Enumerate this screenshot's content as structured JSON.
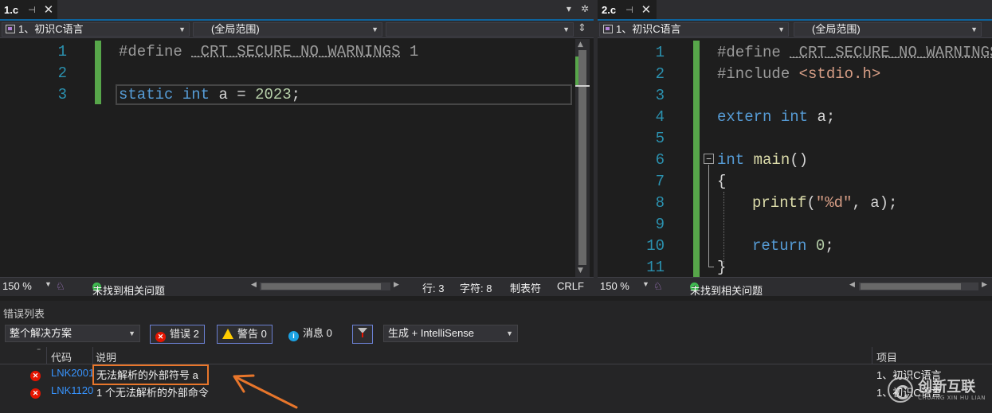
{
  "left_pane": {
    "tab_title": "1.c",
    "nav_project": "1、初识C语言",
    "nav_scope": "(全局范围)",
    "lines": [
      "1",
      "2",
      "3"
    ],
    "code": {
      "line1_directive": "#define",
      "line1_macro": "_CRT_SECURE_NO_WARNINGS",
      "line1_value": "1",
      "line3_kw1": "static",
      "line3_kw2": "int",
      "line3_rest": "a = ",
      "line3_num": "2023",
      "line3_semi": ";"
    },
    "status": {
      "zoom": "150 %",
      "issues": "未找到相关问题",
      "line": "行: 3",
      "char": "字符: 8",
      "tab_mode": "制表符",
      "eol": "CRLF"
    }
  },
  "right_pane": {
    "tab_title": "2.c",
    "nav_project": "1、初识C语言",
    "nav_scope": "(全局范围)",
    "lines": [
      "1",
      "2",
      "3",
      "4",
      "5",
      "6",
      "7",
      "8",
      "9",
      "10",
      "11"
    ],
    "code": {
      "l1_directive": "#define",
      "l1_macro": "_CRT_SECURE_NO_WARNINGS",
      "l2_directive": "#include",
      "l2_header": "<stdio.h>",
      "l4_kw1": "extern",
      "l4_kw2": "int",
      "l4_rest": "a;",
      "l6_collapse": "−",
      "l6_kw": "int",
      "l6_fn": "main",
      "l6_rest": "()",
      "l7": "{",
      "l8_fn": "printf",
      "l8_open": "(",
      "l8_str": "\"%d\"",
      "l8_rest": ", a);",
      "l10_kw": "return",
      "l10_num": "0",
      "l10_semi": ";",
      "l11": "}"
    },
    "status": {
      "zoom": "150 %",
      "issues": "未找到相关问题"
    }
  },
  "error_list": {
    "title": "错误列表",
    "scope": "整个解决方案",
    "errors_btn": "错误 2",
    "warnings_btn": "警告 0",
    "messages_btn": "消息 0",
    "build_filter": "生成 + IntelliSense",
    "col_code": "代码",
    "col_desc": "说明",
    "col_project": "项目",
    "rows": [
      {
        "code": "LNK2001",
        "desc": "无法解析的外部符号 a",
        "project": "1、初识C语言"
      },
      {
        "code": "LNK1120",
        "desc": "1 个无法解析的外部命令",
        "project": "1、初识C语言"
      }
    ]
  },
  "watermark": {
    "text": "创新互联",
    "sub": "CHUANG XIN HU LIAN"
  },
  "colors": {
    "accent": "#0e639c",
    "keyword": "#569cd6",
    "line_number": "#2b91af",
    "change_bar": "#57a64a",
    "error": "#e51400",
    "highlight": "#e8762b"
  }
}
